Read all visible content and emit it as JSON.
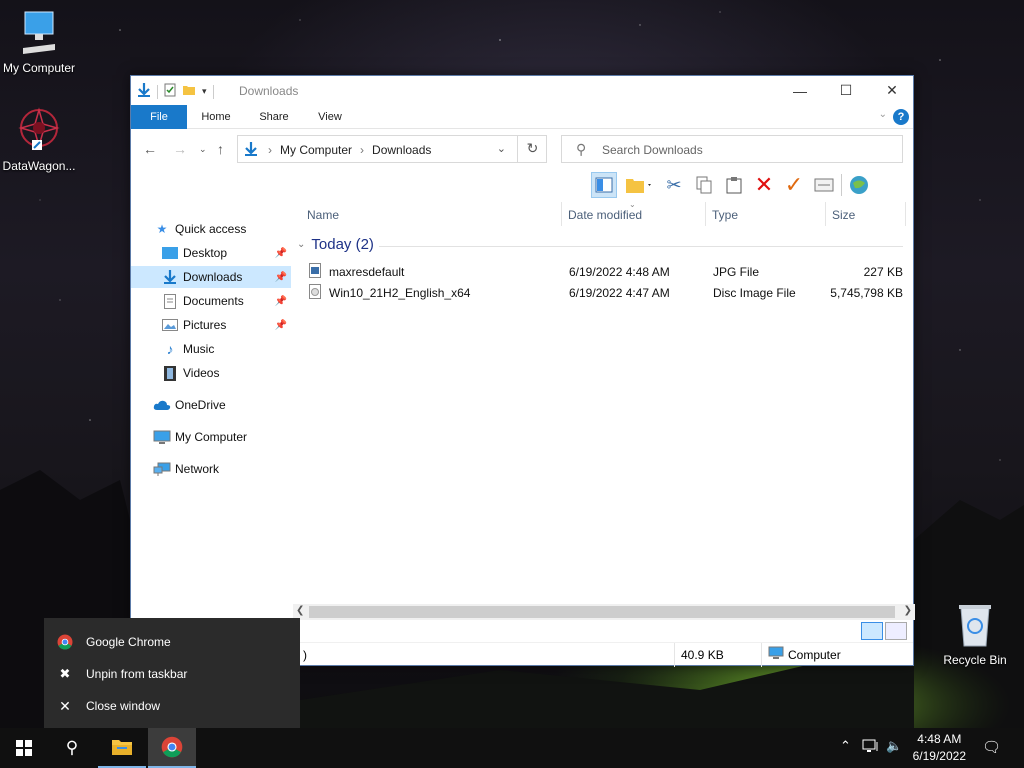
{
  "desktop": {
    "icons": [
      {
        "label": "My Computer"
      },
      {
        "label": "DataWagon..."
      },
      {
        "label": "Recycle Bin"
      }
    ]
  },
  "window": {
    "title": "Downloads",
    "ribbon_tabs": [
      "File",
      "Home",
      "Share",
      "View"
    ],
    "help": "?",
    "breadcrumbs": [
      "My Computer",
      "Downloads"
    ],
    "search_placeholder": "Search Downloads",
    "nav": {
      "quick_access": "Quick access",
      "desktop": "Desktop",
      "downloads": "Downloads",
      "documents": "Documents",
      "pictures": "Pictures",
      "music": "Music",
      "videos": "Videos",
      "onedrive": "OneDrive",
      "my_computer": "My Computer",
      "network": "Network"
    },
    "columns": [
      "Name",
      "Date modified",
      "Type",
      "Size"
    ],
    "group": "Today (2)",
    "files": [
      {
        "name": "maxresdefault",
        "date": "6/19/2022 4:48 AM",
        "type": "JPG File",
        "size": "227 KB"
      },
      {
        "name": "Win10_21H2_English_x64",
        "date": "6/19/2022 4:47 AM",
        "type": "Disc Image File",
        "size": "5,745,798 KB"
      }
    ],
    "status": {
      "left": ")",
      "size": "40.9 KB",
      "location": "Computer"
    }
  },
  "jumplist": {
    "app": "Google Chrome",
    "unpin": "Unpin from taskbar",
    "close": "Close window"
  },
  "taskbar": {
    "time": "4:48 AM",
    "date": "6/19/2022"
  },
  "colors": {
    "accent": "#1979ca",
    "selection": "#cce8ff",
    "taskbar": "#101010",
    "jumplist": "#2b2b2b"
  }
}
